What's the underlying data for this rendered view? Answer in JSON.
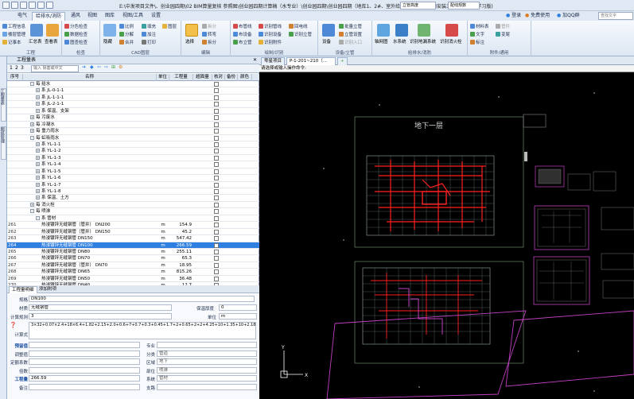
{
  "window": {
    "title": "E:\\中发项目文件\\、创业园四期\\02 BIM算量复核 参照图\\创业园四期计算稿（水专业）\\创业园四期\\创业园四期（地库1、2#、室外给排水）.lAz - BIM安装三维算量软件(学习版)"
  },
  "titlebar": {
    "scope_select": "立管高度",
    "scope_select2": "配线规数",
    "login": "登录",
    "free_use": "免费使用",
    "qq_group": "加QQ群",
    "search_placeholder": "查找文字"
  },
  "menu": {
    "tabs": [
      "电气",
      "给排水/消防",
      "通风",
      "视图",
      "图库",
      "视图/工具",
      "设置"
    ],
    "active_index": 1
  },
  "ribbon": {
    "groups": [
      {
        "label": "工程",
        "items": [
          "工程信息",
          "楼层管理",
          "记事本",
          "汇总表",
          "查看表"
        ]
      },
      {
        "label": "检查",
        "items": [
          "分色检查",
          "数据检查",
          "图查检查"
        ]
      },
      {
        "label": "CAD图层",
        "items": [
          "隐藏",
          "比例",
          "分解",
          "合并",
          "填充",
          "加注",
          "打印",
          "图层"
        ]
      },
      {
        "label": "编辑",
        "items": [
          "选择",
          "拆分",
          "转弯",
          "拆分"
        ]
      },
      {
        "label": "绘制/识别",
        "items": [
          "布管线",
          "布设备",
          "布立管",
          "识别管线",
          "识别设备",
          "识别附件",
          "识别立管",
          "识别管道",
          "回电线"
        ]
      },
      {
        "label": "设备/立管",
        "items": [
          "设备",
          "批量立管",
          "立管设置",
          "识别入口"
        ]
      },
      {
        "label": "给排水/消防",
        "items": [
          "轴网图",
          "水系统",
          "识别地漏系统",
          "识别消火栓"
        ]
      },
      {
        "label": "附件/通用",
        "items": [
          "材料表",
          "文字",
          "标注",
          "管件",
          "变尾"
        ]
      }
    ]
  },
  "vertical_tabs": [
    "工程量表",
    "图纸管理"
  ],
  "left_panel": {
    "title": "工程量表",
    "search_placeholder": "输入 除套或中文",
    "columns": [
      "序号",
      "名称",
      "单位",
      "工程量",
      "超面量",
      "核对",
      "备份",
      "颜色"
    ],
    "rows": [
      {
        "num": "",
        "indent": 1,
        "expand": "-",
        "name": "每 给水",
        "unit": "",
        "qty": ""
      },
      {
        "num": "",
        "indent": 2,
        "expand": "+",
        "name": "系 JL-0-1-1",
        "unit": "",
        "qty": ""
      },
      {
        "num": "",
        "indent": 2,
        "expand": "+",
        "name": "系 JL-1-1-1",
        "unit": "",
        "qty": ""
      },
      {
        "num": "",
        "indent": 2,
        "expand": "+",
        "name": "系 JL-2-1-1",
        "unit": "",
        "qty": ""
      },
      {
        "num": "",
        "indent": 2,
        "expand": "+",
        "name": "系 保温、支架",
        "unit": "",
        "qty": ""
      },
      {
        "num": "",
        "indent": 1,
        "expand": "+",
        "name": "每 污废水",
        "unit": "",
        "qty": ""
      },
      {
        "num": "",
        "indent": 1,
        "expand": "+",
        "name": "每 冷凝水",
        "unit": "",
        "qty": ""
      },
      {
        "num": "",
        "indent": 1,
        "expand": "+",
        "name": "每 重力雨水",
        "unit": "",
        "qty": ""
      },
      {
        "num": "",
        "indent": 1,
        "expand": "-",
        "name": "每 虹吸雨水",
        "unit": "",
        "qty": ""
      },
      {
        "num": "",
        "indent": 2,
        "expand": "+",
        "name": "系 YL-1-1",
        "unit": "",
        "qty": ""
      },
      {
        "num": "",
        "indent": 2,
        "expand": "+",
        "name": "系 YL-1-2",
        "unit": "",
        "qty": ""
      },
      {
        "num": "",
        "indent": 2,
        "expand": "+",
        "name": "系 YL-1-3",
        "unit": "",
        "qty": ""
      },
      {
        "num": "",
        "indent": 2,
        "expand": "+",
        "name": "系 YL-1-4",
        "unit": "",
        "qty": ""
      },
      {
        "num": "",
        "indent": 2,
        "expand": "+",
        "name": "系 YL-1-5",
        "unit": "",
        "qty": ""
      },
      {
        "num": "",
        "indent": 2,
        "expand": "+",
        "name": "系 YL-1-6",
        "unit": "",
        "qty": ""
      },
      {
        "num": "",
        "indent": 2,
        "expand": "+",
        "name": "系 YL-1-7",
        "unit": "",
        "qty": ""
      },
      {
        "num": "",
        "indent": 2,
        "expand": "+",
        "name": "系 YL-1-8",
        "unit": "",
        "qty": ""
      },
      {
        "num": "",
        "indent": 2,
        "expand": "+",
        "name": "系 保温、土方",
        "unit": "",
        "qty": ""
      },
      {
        "num": "",
        "indent": 1,
        "expand": "+",
        "name": "每 消火栓",
        "unit": "",
        "qty": ""
      },
      {
        "num": "",
        "indent": 1,
        "expand": "-",
        "name": "每 喷淋",
        "unit": "",
        "qty": ""
      },
      {
        "num": "",
        "indent": 2,
        "expand": "-",
        "name": "系 管材",
        "unit": "",
        "qty": ""
      },
      {
        "num": "261",
        "indent": 3,
        "expand": "",
        "name": "热浸镀锌无缝钢管（管井） DN200",
        "unit": "m",
        "qty": "154.9"
      },
      {
        "num": "262",
        "indent": 3,
        "expand": "",
        "name": "热浸镀锌无缝钢管（管井） DN150",
        "unit": "m",
        "qty": "45.2"
      },
      {
        "num": "263",
        "indent": 3,
        "expand": "",
        "name": "热浸镀锌无缝钢管 DN150",
        "unit": "m",
        "qty": "547.42"
      },
      {
        "num": "264",
        "indent": 3,
        "expand": "",
        "name": "热浸镀锌无缝钢管 DN100",
        "unit": "m",
        "qty": "266.59",
        "selected": true
      },
      {
        "num": "265",
        "indent": 3,
        "expand": "",
        "name": "热浸镀锌无缝钢管 DN80",
        "unit": "m",
        "qty": "255.11"
      },
      {
        "num": "266",
        "indent": 3,
        "expand": "",
        "name": "热浸镀锌无缝钢管 DN70",
        "unit": "m",
        "qty": "65.3"
      },
      {
        "num": "267",
        "indent": 3,
        "expand": "",
        "name": "热浸镀锌无缝钢管（管井） DN70",
        "unit": "m",
        "qty": "18.95"
      },
      {
        "num": "268",
        "indent": 3,
        "expand": "",
        "name": "热浸镀锌无缝钢管 DN65",
        "unit": "m",
        "qty": "815.26"
      },
      {
        "num": "269",
        "indent": 3,
        "expand": "",
        "name": "热浸镀锌无缝钢管 DN50",
        "unit": "m",
        "qty": "36.48"
      },
      {
        "num": "270",
        "indent": 3,
        "expand": "",
        "name": "热浸镀锌无缝钢管 DN40",
        "unit": "m",
        "qty": "12.7"
      }
    ]
  },
  "detail": {
    "tabs": [
      "工程量明细",
      "添加附项"
    ],
    "spec_label": "规格",
    "spec_value": "DN100",
    "material_label": "材质",
    "material_value": "无缝钢管",
    "insulation_label": "保温厚度",
    "insulation_value": "0",
    "rule_label": "计算规则",
    "rule_value": "3",
    "unit_label": "单位",
    "unit_value": "m",
    "formula_label": "计算式",
    "formula_value": "3×32+0.07×2.4+18×6.4+1.82+2.15+2.0+0.6+7+0.7+0.3+0.45+1.7+2+0.65+2+2+4.25+10+1.35+10+2.18+2+0.6+0.8+1.8+4.2+2+0.8+0.8+2.9+0.9+1.66+2.61+2.28+1.6+1.8+1.2+1.7+0.5+1.1+2.1+3.0+2.4+1.2+1.5+0.8",
    "fields_left": [
      {
        "label": "预留值",
        "value": ""
      },
      {
        "label": "调整值",
        "value": ""
      },
      {
        "label": "定额系数",
        "value": ""
      },
      {
        "label": "倍数",
        "value": ""
      },
      {
        "label": "工程量",
        "value": "266.59"
      },
      {
        "label": "备注",
        "value": ""
      }
    ],
    "fields_right": [
      {
        "label": "专业",
        "value": ""
      },
      {
        "label": "分类",
        "value": "管道"
      },
      {
        "label": "区域",
        "value": "地下"
      },
      {
        "label": "部位",
        "value": "喷淋"
      },
      {
        "label": "系统",
        "value": "管材"
      },
      {
        "label": "支路",
        "value": ""
      }
    ]
  },
  "cad": {
    "tabs": [
      "零星项目",
      "P-1-201~210（...",
      "+"
    ],
    "command_prompt": "请选择或输入操作命令:",
    "drawing_title": "地下一层",
    "axis_y": "Y",
    "axis_x": "X"
  },
  "colors": {
    "accent": "#2f7fe0",
    "cad_background": "#000000",
    "red_pipe": "#ff2020",
    "magenta_frame": "#c040c0"
  }
}
